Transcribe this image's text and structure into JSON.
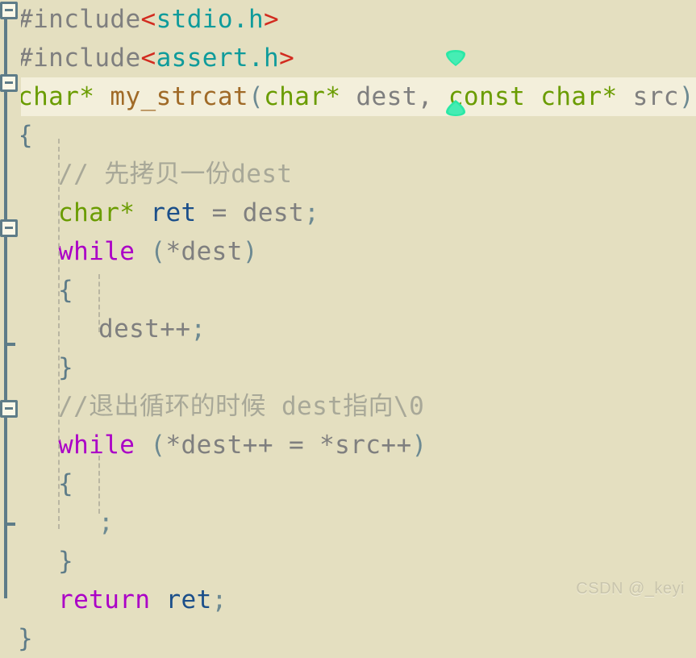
{
  "editor": {
    "background_color": "#e4dfc0",
    "current_line_color": "#f3efdb",
    "gutter_color": "#5e7c88",
    "font_size_px": 31
  },
  "watermark": {
    "text": "CSDN @_keyi"
  },
  "selection": {
    "handle_color": "#1fe6a0",
    "top_handle_label": "selection-handle-top",
    "bottom_handle_label": "selection-handle-bottom"
  },
  "code": {
    "language": "c",
    "lines": [
      {
        "n": 1,
        "indent": 0,
        "current": false,
        "fold": "collapsible",
        "tokens": [
          {
            "t": "#include",
            "c": "t-pre"
          },
          {
            "t": "<",
            "c": "t-angle"
          },
          {
            "t": "stdio.h",
            "c": "t-hdr"
          },
          {
            "t": ">",
            "c": "t-angle"
          }
        ],
        "text": "#include<stdio.h>"
      },
      {
        "n": 2,
        "indent": 0,
        "current": false,
        "fold": "none",
        "tokens": [
          {
            "t": "#include",
            "c": "t-pre"
          },
          {
            "t": "<",
            "c": "t-angle"
          },
          {
            "t": "assert.h",
            "c": "t-hdr"
          },
          {
            "t": ">",
            "c": "t-angle"
          }
        ],
        "text": "#include<assert.h>"
      },
      {
        "n": 3,
        "indent": 0,
        "current": true,
        "fold": "collapsible",
        "tokens": [
          {
            "t": "char*",
            "c": "t-type"
          },
          {
            "t": " ",
            "c": "t-plain"
          },
          {
            "t": "my_strcat",
            "c": "t-fn"
          },
          {
            "t": "(",
            "c": "t-punct"
          },
          {
            "t": "char*",
            "c": "t-type"
          },
          {
            "t": " dest, ",
            "c": "t-plain"
          },
          {
            "t": "const",
            "c": "t-type"
          },
          {
            "t": " ",
            "c": "t-plain"
          },
          {
            "t": "char*",
            "c": "t-type"
          },
          {
            "t": " src",
            "c": "t-plain"
          },
          {
            "t": ")",
            "c": "t-punct"
          }
        ],
        "text": "char* my_strcat(char* dest, const char* src)"
      },
      {
        "n": 4,
        "indent": 0,
        "current": false,
        "fold": "none",
        "tokens": [
          {
            "t": "{",
            "c": "t-brace"
          }
        ],
        "text": "{"
      },
      {
        "n": 5,
        "indent": 1,
        "current": false,
        "fold": "none",
        "tokens": [
          {
            "t": "// 先拷贝一份dest",
            "c": "t-cmt"
          }
        ],
        "text": "// 先拷贝一份dest"
      },
      {
        "n": 6,
        "indent": 1,
        "current": false,
        "fold": "none",
        "tokens": [
          {
            "t": "char*",
            "c": "t-type"
          },
          {
            "t": " ",
            "c": "t-plain"
          },
          {
            "t": "ret",
            "c": "t-var"
          },
          {
            "t": " = dest",
            "c": "t-plain"
          },
          {
            "t": ";",
            "c": "t-punct"
          }
        ],
        "text": "char* ret = dest;"
      },
      {
        "n": 7,
        "indent": 1,
        "current": false,
        "fold": "collapsible",
        "tokens": [
          {
            "t": "while",
            "c": "t-kw"
          },
          {
            "t": " ",
            "c": "t-plain"
          },
          {
            "t": "(",
            "c": "t-punct"
          },
          {
            "t": "*dest",
            "c": "t-plain"
          },
          {
            "t": ")",
            "c": "t-punct"
          }
        ],
        "text": "while (*dest)"
      },
      {
        "n": 8,
        "indent": 1,
        "current": false,
        "fold": "none",
        "tokens": [
          {
            "t": "{",
            "c": "t-brace"
          }
        ],
        "text": "{"
      },
      {
        "n": 9,
        "indent": 2,
        "current": false,
        "fold": "none",
        "tokens": [
          {
            "t": "dest++",
            "c": "t-plain"
          },
          {
            "t": ";",
            "c": "t-punct"
          }
        ],
        "text": "dest++;"
      },
      {
        "n": 10,
        "indent": 1,
        "current": false,
        "fold": "end",
        "tokens": [
          {
            "t": "}",
            "c": "t-brace"
          }
        ],
        "text": "}"
      },
      {
        "n": 11,
        "indent": 1,
        "current": false,
        "fold": "none",
        "tokens": [
          {
            "t": "//退出循环的时候 dest指向\\0",
            "c": "t-cmt"
          }
        ],
        "text": "//退出循环的时候 dest指向\\0"
      },
      {
        "n": 12,
        "indent": 1,
        "current": false,
        "fold": "collapsible",
        "tokens": [
          {
            "t": "while",
            "c": "t-kw"
          },
          {
            "t": " ",
            "c": "t-plain"
          },
          {
            "t": "(",
            "c": "t-punct"
          },
          {
            "t": "*dest++ = *src++",
            "c": "t-plain"
          },
          {
            "t": ")",
            "c": "t-punct"
          }
        ],
        "text": "while (*dest++ = *src++)"
      },
      {
        "n": 13,
        "indent": 1,
        "current": false,
        "fold": "none",
        "tokens": [
          {
            "t": "{",
            "c": "t-brace"
          }
        ],
        "text": "{"
      },
      {
        "n": 14,
        "indent": 2,
        "current": false,
        "fold": "none",
        "tokens": [
          {
            "t": ";",
            "c": "t-punct"
          }
        ],
        "text": ";"
      },
      {
        "n": 15,
        "indent": 1,
        "current": false,
        "fold": "end",
        "tokens": [
          {
            "t": "}",
            "c": "t-brace"
          }
        ],
        "text": "}"
      },
      {
        "n": 16,
        "indent": 1,
        "current": false,
        "fold": "none",
        "tokens": [
          {
            "t": "return",
            "c": "t-kw"
          },
          {
            "t": " ",
            "c": "t-plain"
          },
          {
            "t": "ret",
            "c": "t-var"
          },
          {
            "t": ";",
            "c": "t-punct"
          }
        ],
        "text": "return ret;"
      },
      {
        "n": 17,
        "indent": 0,
        "current": false,
        "fold": "none",
        "tokens": [
          {
            "t": "}",
            "c": "t-brace"
          }
        ],
        "text": "}"
      }
    ]
  }
}
